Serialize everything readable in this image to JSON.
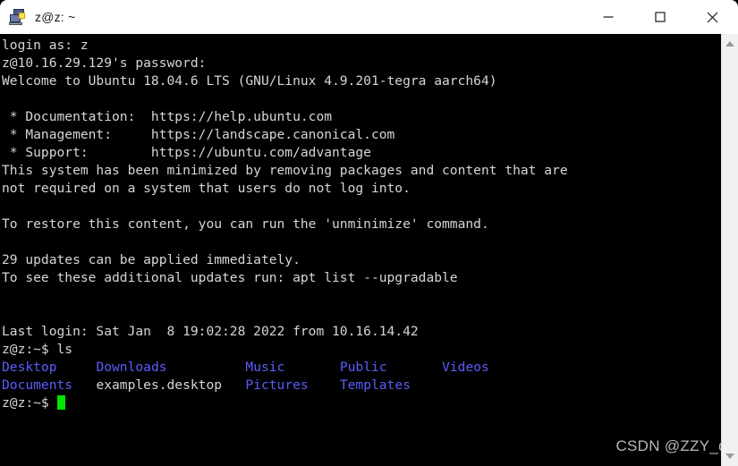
{
  "window": {
    "title": "z@z: ~",
    "app_icon": "putty-icon",
    "controls": {
      "minimize": "minimize-icon",
      "maximize": "maximize-icon",
      "close": "close-icon"
    }
  },
  "terminal": {
    "background_color": "#000000",
    "foreground_color": "#d6d6d6",
    "directory_color": "#5c5cff",
    "cursor_color": "#00e500",
    "lines": [
      {
        "text": "login as: z"
      },
      {
        "text": "z@10.16.29.129's password:"
      },
      {
        "text": "Welcome to Ubuntu 18.04.6 LTS (GNU/Linux 4.9.201-tegra aarch64)"
      },
      {
        "text": ""
      },
      {
        "text": " * Documentation:  https://help.ubuntu.com"
      },
      {
        "text": " * Management:     https://landscape.canonical.com"
      },
      {
        "text": " * Support:        https://ubuntu.com/advantage"
      },
      {
        "text": "This system has been minimized by removing packages and content that are"
      },
      {
        "text": "not required on a system that users do not log into."
      },
      {
        "text": ""
      },
      {
        "text": "To restore this content, you can run the 'unminimize' command."
      },
      {
        "text": ""
      },
      {
        "text": "29 updates can be applied immediately."
      },
      {
        "text": "To see these additional updates run: apt list --upgradable"
      },
      {
        "text": ""
      },
      {
        "text": ""
      },
      {
        "text": "Last login: Sat Jan  8 19:02:28 2022 from 10.16.14.42"
      },
      {
        "text": "z@z:~$ ls"
      }
    ],
    "ls_row_1": {
      "col1": "Desktop",
      "gap1": "     ",
      "col2": "Downloads",
      "gap2": "          ",
      "col3": "Music",
      "gap3": "       ",
      "col4": "Public",
      "gap4": "       ",
      "col5": "Videos"
    },
    "ls_row_2": {
      "col1": "Documents",
      "gap1": "   ",
      "col2": "examples.desktop",
      "gap2": "   ",
      "col3": "Pictures",
      "gap3": "    ",
      "col4": "Templates"
    },
    "prompt": "z@z:~$ "
  },
  "watermark": {
    "text": "CSDN @ZZY_dl"
  },
  "scrollbar": {
    "up_arrow": "scroll-up-arrow",
    "down_arrow": "scroll-down-arrow"
  }
}
